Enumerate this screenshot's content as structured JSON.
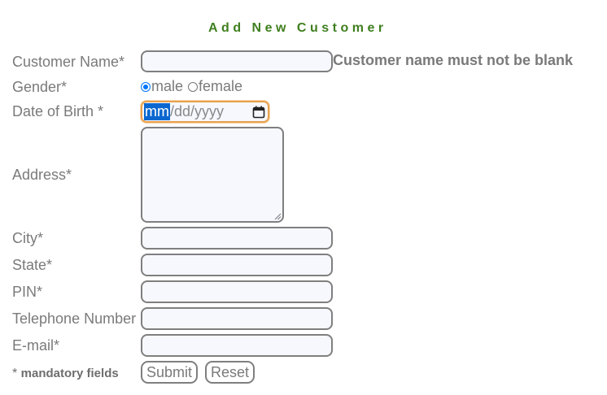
{
  "form": {
    "title": "Add New Customer",
    "fields": {
      "customer_name": {
        "label": "Customer Name*",
        "value": "",
        "error": "Customer name must not be blank"
      },
      "gender": {
        "label": "Gender*",
        "options": [
          "male",
          "female"
        ],
        "selected": "male"
      },
      "date_of_birth": {
        "label": "Date of Birth *",
        "mm": "mm",
        "rest": "/dd/yyyy"
      },
      "address": {
        "label": "Address*",
        "value": ""
      },
      "city": {
        "label": "City*",
        "value": ""
      },
      "state": {
        "label": "State*",
        "value": ""
      },
      "pin": {
        "label": "PIN*",
        "value": ""
      },
      "telephone": {
        "label": "Telephone Number",
        "value": ""
      },
      "email": {
        "label": "E-mail*",
        "value": ""
      }
    },
    "mandatory_note": {
      "star": "* ",
      "text": "mandatory fields"
    },
    "buttons": {
      "submit": "Submit",
      "reset": "Reset"
    }
  },
  "icons": {
    "date_picker": "calendar-icon"
  },
  "colors": {
    "title": "#3f7f1f",
    "date_focus": "#e9a14e",
    "selection": "#0a67d0",
    "radio_checked": "#0075ff"
  }
}
